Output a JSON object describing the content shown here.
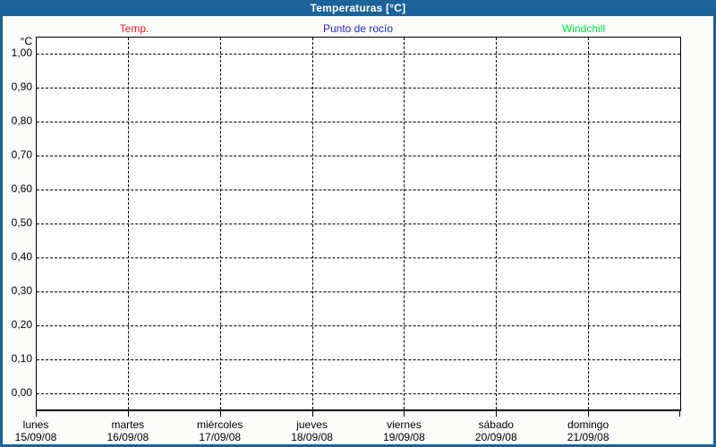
{
  "window": {
    "title": "Temperaturas [°C]",
    "colors": {
      "frame": "#1c6399",
      "background": "#fcfdfb",
      "plot_background": "#ffffff",
      "grid": "#000000"
    }
  },
  "legend": {
    "items": [
      {
        "label": "Temp.",
        "color": "#ff1414"
      },
      {
        "label": "Punto de rocío",
        "color": "#2323cc"
      },
      {
        "label": "Windchill",
        "color": "#00dd44"
      }
    ]
  },
  "chart_data": {
    "type": "line",
    "title": "Temperaturas [°C]",
    "ylabel": "°C",
    "ylim": [
      0.0,
      1.0
    ],
    "y_tick_step": 0.1,
    "y_tick_labels": [
      "1,00",
      "0,90",
      "0,80",
      "0,70",
      "0,60",
      "0,50",
      "0,40",
      "0,30",
      "0,20",
      "0,10",
      "0,00"
    ],
    "x_categories": [
      {
        "day": "lunes",
        "date": "15/09/08"
      },
      {
        "day": "martes",
        "date": "16/09/08"
      },
      {
        "day": "miércoles",
        "date": "17/09/08"
      },
      {
        "day": "jueves",
        "date": "18/09/08"
      },
      {
        "day": "viernes",
        "date": "19/09/08"
      },
      {
        "day": "sábado",
        "date": "20/09/08"
      },
      {
        "day": "domingo",
        "date": "21/09/08"
      }
    ],
    "series": [
      {
        "name": "Temp.",
        "color": "#ff1414",
        "values": []
      },
      {
        "name": "Punto de rocío",
        "color": "#2323cc",
        "values": []
      },
      {
        "name": "Windchill",
        "color": "#00dd44",
        "values": []
      }
    ],
    "grid": "dashed",
    "legend_position": "top"
  }
}
